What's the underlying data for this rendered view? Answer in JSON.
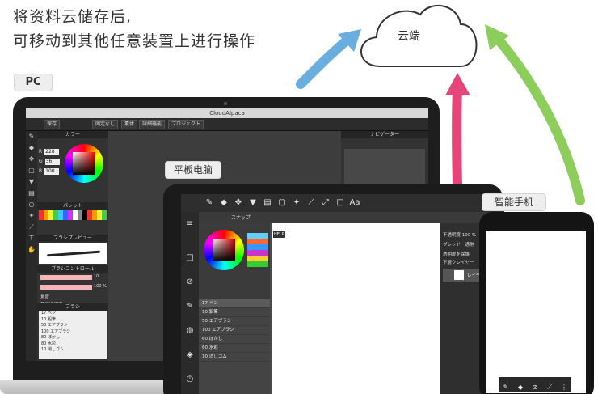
{
  "headline": {
    "line1": "将资料云储存后,",
    "line2": "可移动到其他任意装置上进行操作"
  },
  "cloud": {
    "label": "云端"
  },
  "tags": {
    "pc": "PC",
    "tablet": "平板电脑",
    "phone": "智能手机"
  },
  "colors": {
    "arrow_blue": "#6aaee0",
    "arrow_pink": "#e6457a",
    "arrow_green": "#8ccd5c"
  },
  "laptop_app": {
    "title": "CloudAlpaca",
    "toolbar": [
      "保存",
      "固定なし",
      "素体",
      "詳細機能",
      "プロジェクト"
    ],
    "color_panel_title": "カラー",
    "rgb": [
      {
        "label": "R",
        "value": "228"
      },
      {
        "label": "G",
        "value": "36"
      },
      {
        "label": "B",
        "value": "100"
      }
    ],
    "palette_title": "パレット",
    "brush_preview_title": "ブラシプレビュー",
    "brush_control_title": "ブラシコントロール",
    "size_value": "10",
    "opacity_value": "100 %",
    "angle_label": "角度",
    "pressure_label": "筆圧透明度",
    "brush_title": "ブラシ",
    "navigator_title": "ナビゲーター",
    "brushes": [
      {
        "size": "17",
        "name": "ペン"
      },
      {
        "size": "10",
        "name": "鉛筆"
      },
      {
        "size": "50",
        "name": "エアブラシ"
      },
      {
        "size": "100",
        "name": "エアブラシ"
      },
      {
        "size": "80",
        "name": "ぼかし"
      },
      {
        "size": "80",
        "name": "水彩"
      },
      {
        "size": "10",
        "name": "消しゴム"
      }
    ]
  },
  "tablet_app": {
    "snap_label": "スナップ",
    "brushes": [
      {
        "size": "17",
        "name": "ペン"
      },
      {
        "size": "10",
        "name": "鉛筆"
      },
      {
        "size": "50",
        "name": "エアブラシ"
      },
      {
        "size": "100",
        "name": "エアブラシ"
      },
      {
        "size": "60",
        "name": "ぼかし"
      },
      {
        "size": "60",
        "name": "水彩"
      },
      {
        "size": "10",
        "name": "消しゴム"
      }
    ],
    "layer_tabs": "ブレンド　通常",
    "opacity_label": "不透明度 100 %",
    "check_protect": "透明度を保護",
    "check_clip": "下層クレイヤー",
    "layer_name": "レイヤー",
    "help": "HELP"
  }
}
